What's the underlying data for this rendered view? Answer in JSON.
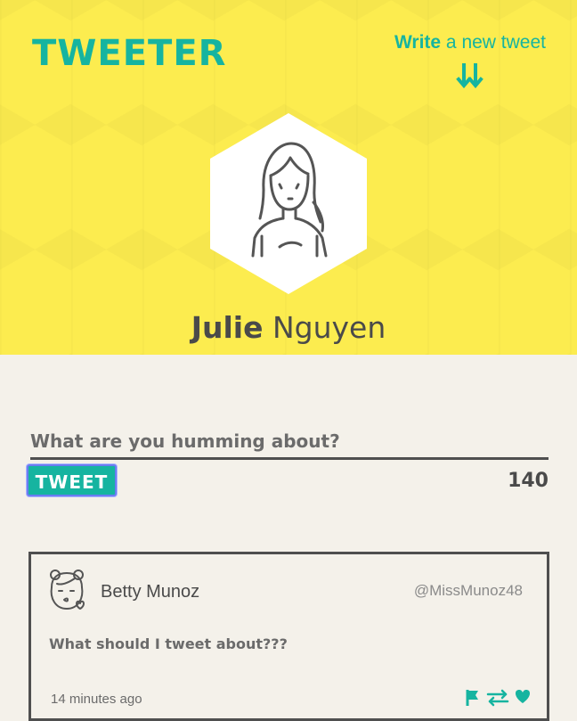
{
  "header": {
    "logo": "TWEETER",
    "write_bold": "Write",
    "write_rest": " a new tweet",
    "arrow_icon": "double-down-arrow-icon"
  },
  "profile": {
    "first_name": "Julie",
    "last_name": " Nguyen",
    "avatar_icon": "girl-avatar-icon"
  },
  "compose": {
    "placeholder": "What are you humming about?",
    "button_label": "TWEET",
    "char_count": "140"
  },
  "feed": [
    {
      "author": "Betty Munoz",
      "handle": "@MissMunoz48",
      "text": "What should I tweet about???",
      "time": "14 minutes ago",
      "avatar_icon": "kissing-girl-avatar-icon",
      "actions": [
        "flag-icon",
        "retweet-icon",
        "heart-icon"
      ]
    }
  ],
  "colors": {
    "accent": "#16b4a0",
    "hero_bg": "#fcec4f",
    "page_bg": "#f4f1ea",
    "text_dark": "#4a4a4a"
  }
}
